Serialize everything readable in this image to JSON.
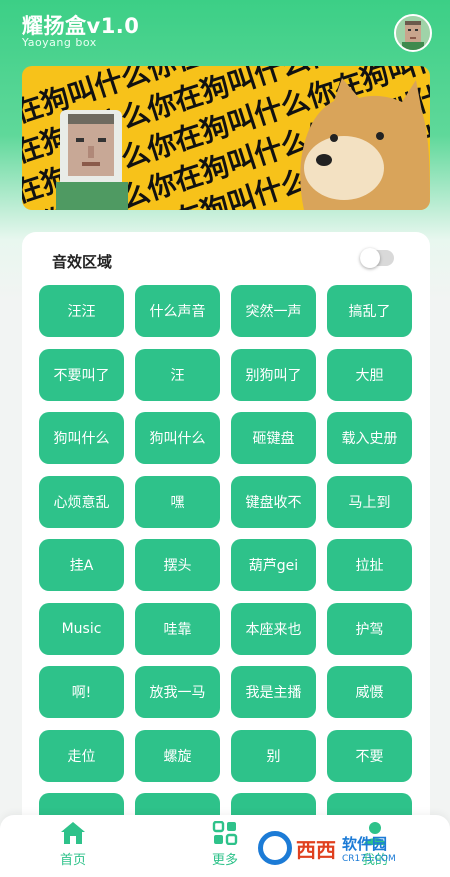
{
  "header": {
    "title": "耀扬盒v1.0",
    "subtitle": "Yaoyang box"
  },
  "banner": {
    "repeat_text": "你在狗叫什么你在狗叫什么你在狗叫什么"
  },
  "sound_section": {
    "title": "音效区域",
    "toggle_on": false,
    "buttons": [
      "汪汪",
      "什么声音",
      "突然一声",
      "搞乱了",
      "不要叫了",
      "汪",
      "别狗叫了",
      "大胆",
      "狗叫什么",
      "狗叫什么",
      "砸键盘",
      "载入史册",
      "心烦意乱",
      "嘿",
      "键盘收不",
      "马上到",
      "挂A",
      "摆头",
      "葫芦gei",
      "拉扯",
      "Music",
      "哇靠",
      "本座来也",
      "护驾",
      "啊!",
      "放我一马",
      "我是主播",
      "威慑",
      "走位",
      "螺旋",
      "别",
      "不要",
      "",
      "",
      "",
      ""
    ]
  },
  "nav": {
    "home_label": "首页",
    "more_label": "更多",
    "mine_label": "我的"
  },
  "watermark": {
    "brand": "西西",
    "name": "软件园",
    "url": "CR173.COM"
  },
  "colors": {
    "accent": "#2ec28a",
    "header": "#3ccf86",
    "banner": "#f7c21a"
  }
}
